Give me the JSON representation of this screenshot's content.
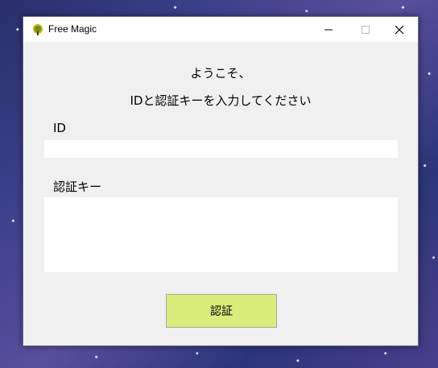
{
  "window": {
    "title": "Free Magic",
    "controls": {
      "minimize": "minimize-icon",
      "maximize": "maximize-icon",
      "close": "close-icon"
    }
  },
  "greeting": {
    "line1": "ようこそ、",
    "line2": "IDと認証キーを入力してください"
  },
  "form": {
    "id_label": "ID",
    "id_value": "",
    "key_label": "認証キー",
    "key_value": "",
    "submit_label": "認証"
  },
  "colors": {
    "button_bg": "#daec7c",
    "window_bg": "#f0f0f0"
  }
}
